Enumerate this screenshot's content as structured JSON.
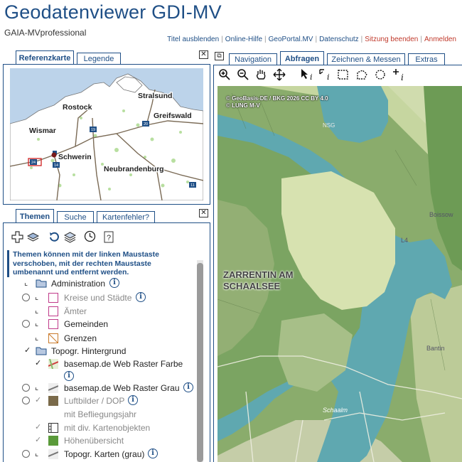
{
  "header": {
    "title": "Geodatenviewer GDI-MV",
    "subtitle": "GAIA-MVprofessional",
    "links": [
      {
        "label": "Titel ausblenden",
        "red": false
      },
      {
        "label": "Online-Hilfe",
        "red": false
      },
      {
        "label": "GeoPortal.MV",
        "red": false
      },
      {
        "label": "Datenschutz",
        "red": false
      },
      {
        "label": "Sitzung beenden",
        "red": true
      },
      {
        "label": "Anmelden",
        "red": true
      }
    ]
  },
  "left_top_tabs": [
    "Referenzkarte",
    "Legende"
  ],
  "refmap": {
    "cities": [
      "Stralsund",
      "Rostock",
      "Greifswald",
      "Wismar",
      "Schwerin",
      "Neubrandenburg"
    ],
    "roads": [
      "19",
      "20",
      "14",
      "11",
      "24"
    ]
  },
  "left_bottom_tabs": [
    "Themen",
    "Suche",
    "Kartenfehler?"
  ],
  "themes": {
    "tool_icons": [
      "add-layer-icon",
      "layers-icon",
      "refresh-icon",
      "layer-stack-icon",
      "clock-icon",
      "help-icon"
    ],
    "help_text": "Themen können mit der linken Maustaste verschoben, mit der rechten Maustaste umbenannt und entfernt werden.",
    "tree": [
      {
        "label": "Administration",
        "type": "folder"
      },
      {
        "label": "Kreise und Städte",
        "type": "layer"
      },
      {
        "label": "Ämter",
        "type": "layer"
      },
      {
        "label": "Gemeinden",
        "type": "layer"
      },
      {
        "label": "Grenzen",
        "type": "layer"
      },
      {
        "label": "Topogr. Hintergrund",
        "type": "folder"
      },
      {
        "label": "basemap.de Web Raster Farbe",
        "type": "layer"
      },
      {
        "label": "basemap.de Web Raster Grau",
        "type": "layer"
      },
      {
        "label": "Luftbilder / DOP",
        "type": "layer"
      },
      {
        "label": "mit Befliegungsjahr",
        "type": "layer"
      },
      {
        "label": "mit div. Kartenobjekten",
        "type": "layer"
      },
      {
        "label": "Höhenübersicht",
        "type": "layer"
      },
      {
        "label": "Topogr. Karten (grau)",
        "type": "layer"
      }
    ]
  },
  "right_tabs": [
    "Navigation",
    "Abfragen",
    "Zeichnen & Messen",
    "Extras"
  ],
  "map_tools": [
    "zoom-in-icon",
    "zoom-out-icon",
    "pan-hand-icon",
    "move-icon",
    "info-pointer-icon",
    "info-multi-icon",
    "select-rect-icon",
    "select-polygon-icon",
    "select-lasso-icon",
    "add-info-icon"
  ],
  "map": {
    "copyright": [
      "© GeoBasis-DE / BKG 2026 CC BY 4.0",
      "© LUNG M-V"
    ],
    "place_label": "ZARRENTIN AM\nSCHAALSEE",
    "labels": [
      "L4",
      "Boissow",
      "Bantin",
      "Schaalm",
      "NSG"
    ]
  },
  "colors": {
    "brand": "#1f4f86",
    "accent_red": "#c0392b"
  }
}
